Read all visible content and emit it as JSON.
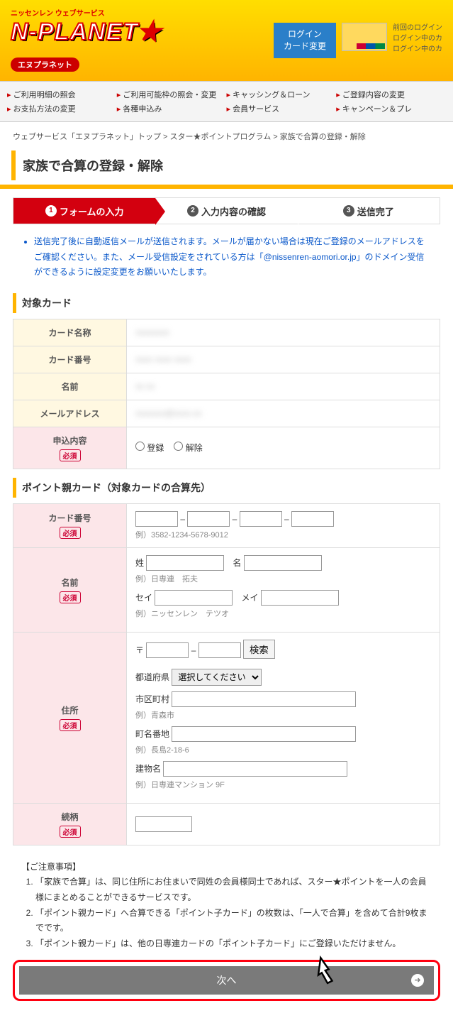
{
  "header": {
    "sub": "ニッセンレン ウェブサービス",
    "logo": "N-PLANET",
    "star": "★",
    "badge": "エヌプラネット",
    "login1": "ログイン",
    "login2": "カード変更",
    "status1": "前回のログイン",
    "status2": "ログイン中のカ",
    "status3": "ログイン中のカ"
  },
  "nav": {
    "c1": [
      "ご利用明細の照会",
      "お支払方法の変更"
    ],
    "c2": [
      "ご利用可能枠の照会・変更",
      "各種申込み"
    ],
    "c3": [
      "キャッシング＆ローン",
      "会員サービス"
    ],
    "c4": [
      "ご登録内容の変更",
      "キャンペーン＆プレ"
    ]
  },
  "crumb": {
    "a": "ウェブサービス「エヌプラネット」トップ",
    "b": "スター★ポイントプログラム",
    "c": "家族で合算の登録・解除"
  },
  "h1": "家族で合算の登録・解除",
  "steps": {
    "s1": "フォームの入力",
    "s2": "入力内容の確認",
    "s3": "送信完了"
  },
  "note": "送信完了後に自動返信メールが送信されます。メールが届かない場合は現在ご登録のメールアドレスをご確認ください。また、メール受信設定をされている方は「@nissenren-aomori.or.jp」のドメイン受信ができるように設定変更をお願いいたします。",
  "sec1": "対象カード",
  "t1": {
    "r1": "カード名称",
    "r2": "カード番号",
    "r3": "名前",
    "r4": "メールアドレス",
    "r5": "申込内容",
    "v1": "xxxxxxxx",
    "v2": "xxxx xxxx xxxx",
    "v3": "xx xx",
    "v4": "xxxxxxx@xxxx.xx",
    "opt1": "登録",
    "opt2": "解除"
  },
  "req": "必須",
  "sec2": "ポイント親カード（対象カードの合算先）",
  "t2": {
    "r1": "カード番号",
    "r1h": "例）3582-1234-5678-9012",
    "r2": "名前",
    "r2a": "姓",
    "r2b": "名",
    "r2h1": "例）日専連　拓夫",
    "r2c": "セイ",
    "r2d": "メイ",
    "r2h2": "例）ニッセンレン　テツオ",
    "r3": "住所",
    "r3a": "〒",
    "r3s": "検索",
    "r3p": "都道府県",
    "r3po": "選択してください",
    "r3c": "市区町村",
    "r3ch": "例）青森市",
    "r3t": "町名番地",
    "r3th": "例）長島2-18-6",
    "r3b": "建物名",
    "r3bh": "例）日専連マンション 9F",
    "r4": "続柄"
  },
  "caut": {
    "h": "【ご注意事項】",
    "l1": "「家族で合算」は、同じ住所にお住まいで同姓の会員様同士であれば、スター★ポイントを一人の会員様にまとめることができるサービスです。",
    "l2": "「ポイント親カード」へ合算できる「ポイント子カード」の枚数は、「一人で合算」を含めて合計9枚までです。",
    "l3": "「ポイント親カード」は、他の日専連カードの「ポイント子カード」にご登録いただけません。"
  },
  "next": "次へ"
}
